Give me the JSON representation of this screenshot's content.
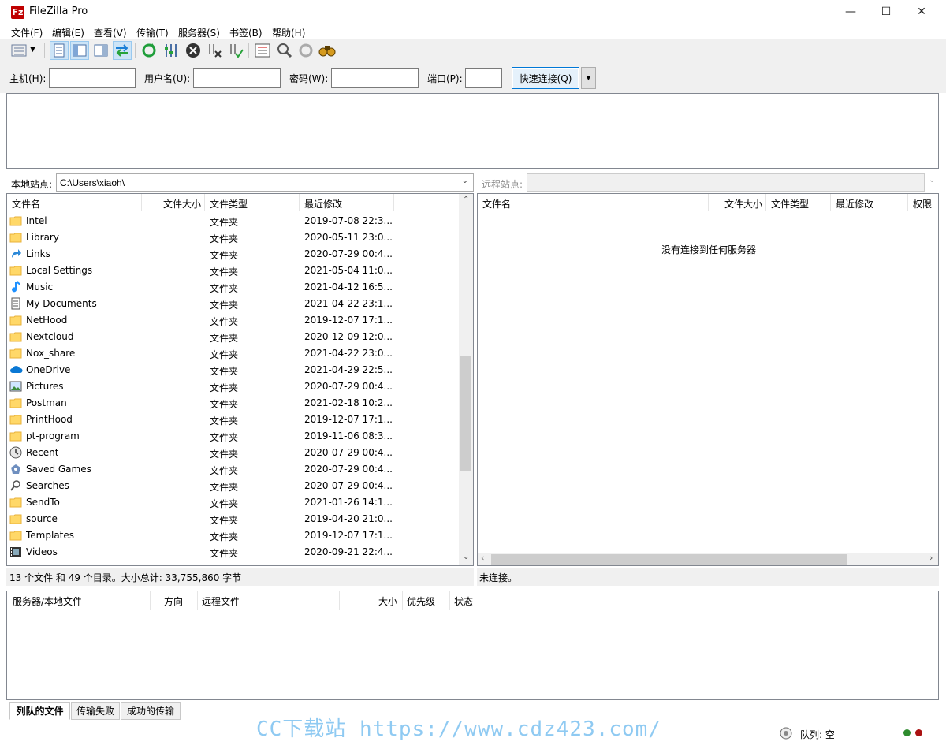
{
  "window": {
    "title": "FileZilla Pro",
    "app_icon": "Fz"
  },
  "menu": [
    "文件(F)",
    "编辑(E)",
    "查看(V)",
    "传输(T)",
    "服务器(S)",
    "书签(B)",
    "帮助(H)"
  ],
  "connect": {
    "host_label": "主机(H):",
    "host_value": "",
    "user_label": "用户名(U):",
    "user_value": "",
    "pass_label": "密码(W):",
    "pass_value": "",
    "port_label": "端口(P):",
    "port_value": "",
    "quickconnect_label": "快速连接(Q)"
  },
  "local": {
    "site_label": "本地站点:",
    "path": "C:\\Users\\xiaoh\\",
    "columns": [
      "文件名",
      "文件大小",
      "文件类型",
      "最近修改"
    ],
    "rows": [
      {
        "name": "Intel",
        "type": "文件夹",
        "modified": "2019-07-08 22:3...",
        "icon": "folder-icon"
      },
      {
        "name": "Library",
        "type": "文件夹",
        "modified": "2020-05-11 23:0...",
        "icon": "folder-icon"
      },
      {
        "name": "Links",
        "type": "文件夹",
        "modified": "2020-07-29 00:4...",
        "icon": "links-icon"
      },
      {
        "name": "Local Settings",
        "type": "文件夹",
        "modified": "2021-05-04 11:0...",
        "icon": "folder-icon"
      },
      {
        "name": "Music",
        "type": "文件夹",
        "modified": "2021-04-12 16:5...",
        "icon": "music-icon"
      },
      {
        "name": "My Documents",
        "type": "文件夹",
        "modified": "2021-04-22 23:1...",
        "icon": "documents-icon"
      },
      {
        "name": "NetHood",
        "type": "文件夹",
        "modified": "2019-12-07 17:1...",
        "icon": "folder-icon"
      },
      {
        "name": "Nextcloud",
        "type": "文件夹",
        "modified": "2020-12-09 12:0...",
        "icon": "folder-icon"
      },
      {
        "name": "Nox_share",
        "type": "文件夹",
        "modified": "2021-04-22 23:0...",
        "icon": "folder-icon"
      },
      {
        "name": "OneDrive",
        "type": "文件夹",
        "modified": "2021-04-29 22:5...",
        "icon": "onedrive-icon"
      },
      {
        "name": "Pictures",
        "type": "文件夹",
        "modified": "2020-07-29 00:4...",
        "icon": "pictures-icon"
      },
      {
        "name": "Postman",
        "type": "文件夹",
        "modified": "2021-02-18 10:2...",
        "icon": "folder-icon"
      },
      {
        "name": "PrintHood",
        "type": "文件夹",
        "modified": "2019-12-07 17:1...",
        "icon": "folder-icon"
      },
      {
        "name": "pt-program",
        "type": "文件夹",
        "modified": "2019-11-06 08:3...",
        "icon": "folder-icon"
      },
      {
        "name": "Recent",
        "type": "文件夹",
        "modified": "2020-07-29 00:4...",
        "icon": "recent-icon"
      },
      {
        "name": "Saved Games",
        "type": "文件夹",
        "modified": "2020-07-29 00:4...",
        "icon": "saved-games-icon"
      },
      {
        "name": "Searches",
        "type": "文件夹",
        "modified": "2020-07-29 00:4...",
        "icon": "search-icon"
      },
      {
        "name": "SendTo",
        "type": "文件夹",
        "modified": "2021-01-26 14:1...",
        "icon": "folder-icon"
      },
      {
        "name": "source",
        "type": "文件夹",
        "modified": "2019-04-20 21:0...",
        "icon": "folder-icon"
      },
      {
        "name": "Templates",
        "type": "文件夹",
        "modified": "2019-12-07 17:1...",
        "icon": "folder-icon"
      },
      {
        "name": "Videos",
        "type": "文件夹",
        "modified": "2020-09-21 22:4...",
        "icon": "videos-icon"
      }
    ],
    "status": "13 个文件 和 49 个目录。大小总计: 33,755,860 字节"
  },
  "remote": {
    "site_label": "远程站点:",
    "path": "",
    "columns": [
      "文件名",
      "文件大小",
      "文件类型",
      "最近修改",
      "权限"
    ],
    "empty_message": "没有连接到任何服务器",
    "status": "未连接。"
  },
  "queue": {
    "columns": [
      "服务器/本地文件",
      "方向",
      "远程文件",
      "大小",
      "优先级",
      "状态"
    ],
    "tabs": [
      "列队的文件",
      "传输失败",
      "成功的传输"
    ],
    "status": "队列: 空"
  },
  "watermark": "CC下载站 https://www.cdz423.com/",
  "colors": {
    "accent": "#0078d7",
    "folder": "#ffd868",
    "chrome": "#f0f0f0"
  }
}
